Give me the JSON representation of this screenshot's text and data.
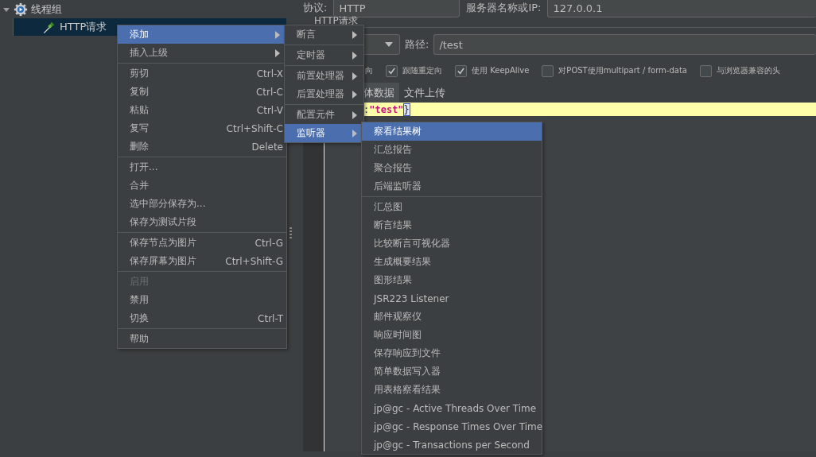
{
  "tree": [
    {
      "label": "线程组",
      "expanded": true,
      "selected": false,
      "children": [
        {
          "label": "HTTP请求",
          "selected": true
        }
      ]
    }
  ],
  "top_row": {
    "protocol_label": "协议:",
    "protocol_value": "HTTP",
    "server_label": "服务器名称或IP:",
    "server_value": "127.0.0.1"
  },
  "section_title": "HTTP请求",
  "path": {
    "label": "路径:",
    "value": "/test"
  },
  "options": [
    {
      "kind": "fragment",
      "label": "向"
    },
    {
      "kind": "checkbox",
      "label": "跟随重定向",
      "checked": true
    },
    {
      "kind": "checkbox",
      "label": "使用 KeepAlive",
      "checked": true
    },
    {
      "kind": "checkbox",
      "label": "对POST使用multipart / form-data",
      "checked": false
    },
    {
      "kind": "checkbox",
      "label": "与浏览器兼容的头",
      "checked": false
    }
  ],
  "tabs": [
    {
      "label": "体数据",
      "selected": true
    },
    {
      "label": "文件上传",
      "selected": false
    }
  ],
  "code_line": [
    {
      "text": ":",
      "kind": "punct"
    },
    {
      "text": "\"test\"",
      "kind": "string"
    },
    {
      "text": "}",
      "kind": "brace"
    }
  ],
  "context_menu": [
    {
      "kind": "submenu",
      "label": "添加",
      "selected": true,
      "disabled": false
    },
    {
      "kind": "submenu",
      "label": "插入上级",
      "selected": false,
      "disabled": false
    },
    {
      "kind": "separator"
    },
    {
      "kind": "item",
      "label": "剪切",
      "shortcut": "Ctrl-X",
      "selected": false,
      "disabled": false
    },
    {
      "kind": "item",
      "label": "复制",
      "shortcut": "Ctrl-C",
      "selected": false,
      "disabled": false
    },
    {
      "kind": "item",
      "label": "粘贴",
      "shortcut": "Ctrl-V",
      "selected": false,
      "disabled": false
    },
    {
      "kind": "item",
      "label": "复写",
      "shortcut": "Ctrl+Shift-C",
      "selected": false,
      "disabled": false
    },
    {
      "kind": "item",
      "label": "删除",
      "shortcut": "Delete",
      "selected": false,
      "disabled": false
    },
    {
      "kind": "separator"
    },
    {
      "kind": "item",
      "label": "打开...",
      "selected": false,
      "disabled": false
    },
    {
      "kind": "item",
      "label": "合并",
      "selected": false,
      "disabled": false
    },
    {
      "kind": "item",
      "label": "选中部分保存为...",
      "selected": false,
      "disabled": false
    },
    {
      "kind": "item",
      "label": "保存为测试片段",
      "selected": false,
      "disabled": false
    },
    {
      "kind": "separator"
    },
    {
      "kind": "item",
      "label": "保存节点为图片",
      "shortcut": "Ctrl-G",
      "selected": false,
      "disabled": false
    },
    {
      "kind": "item",
      "label": "保存屏幕为图片",
      "shortcut": "Ctrl+Shift-G",
      "selected": false,
      "disabled": false
    },
    {
      "kind": "separator"
    },
    {
      "kind": "item",
      "label": "启用",
      "selected": false,
      "disabled": true
    },
    {
      "kind": "item",
      "label": "禁用",
      "selected": false,
      "disabled": false
    },
    {
      "kind": "item",
      "label": "切换",
      "shortcut": "Ctrl-T",
      "selected": false,
      "disabled": false
    },
    {
      "kind": "separator"
    },
    {
      "kind": "item",
      "label": "帮助",
      "selected": false,
      "disabled": false
    }
  ],
  "add_submenu": [
    {
      "kind": "submenu",
      "label": "断言",
      "selected": false,
      "disabled": false
    },
    {
      "kind": "separator"
    },
    {
      "kind": "submenu",
      "label": "定时器",
      "selected": false,
      "disabled": false
    },
    {
      "kind": "separator"
    },
    {
      "kind": "submenu",
      "label": "前置处理器",
      "selected": false,
      "disabled": false
    },
    {
      "kind": "submenu",
      "label": "后置处理器",
      "selected": false,
      "disabled": false
    },
    {
      "kind": "separator"
    },
    {
      "kind": "submenu",
      "label": "配置元件",
      "selected": false,
      "disabled": false
    },
    {
      "kind": "submenu",
      "label": "监听器",
      "selected": true,
      "disabled": false
    }
  ],
  "listener_submenu": [
    {
      "kind": "item",
      "label": "察看结果树",
      "selected": true,
      "disabled": false
    },
    {
      "kind": "item",
      "label": "汇总报告",
      "selected": false,
      "disabled": false
    },
    {
      "kind": "item",
      "label": "聚合报告",
      "selected": false,
      "disabled": false
    },
    {
      "kind": "item",
      "label": "后端监听器",
      "selected": false,
      "disabled": false
    },
    {
      "kind": "separator"
    },
    {
      "kind": "item",
      "label": "汇总图",
      "selected": false,
      "disabled": false
    },
    {
      "kind": "item",
      "label": "断言结果",
      "selected": false,
      "disabled": false
    },
    {
      "kind": "item",
      "label": "比较断言可视化器",
      "selected": false,
      "disabled": false
    },
    {
      "kind": "item",
      "label": "生成概要结果",
      "selected": false,
      "disabled": false
    },
    {
      "kind": "item",
      "label": "图形结果",
      "selected": false,
      "disabled": false
    },
    {
      "kind": "item",
      "label": "JSR223 Listener",
      "selected": false,
      "disabled": false
    },
    {
      "kind": "item",
      "label": "邮件观察仪",
      "selected": false,
      "disabled": false
    },
    {
      "kind": "item",
      "label": "响应时间图",
      "selected": false,
      "disabled": false
    },
    {
      "kind": "item",
      "label": "保存响应到文件",
      "selected": false,
      "disabled": false
    },
    {
      "kind": "item",
      "label": "简单数据写入器",
      "selected": false,
      "disabled": false
    },
    {
      "kind": "item",
      "label": "用表格察看结果",
      "selected": false,
      "disabled": false
    },
    {
      "kind": "item",
      "label": "jp@gc - Active Threads Over Time",
      "selected": false,
      "disabled": false
    },
    {
      "kind": "item",
      "label": "jp@gc - Response Times Over Time",
      "selected": false,
      "disabled": false
    },
    {
      "kind": "item",
      "label": "jp@gc - Transactions per Second",
      "selected": false,
      "disabled": false
    }
  ]
}
